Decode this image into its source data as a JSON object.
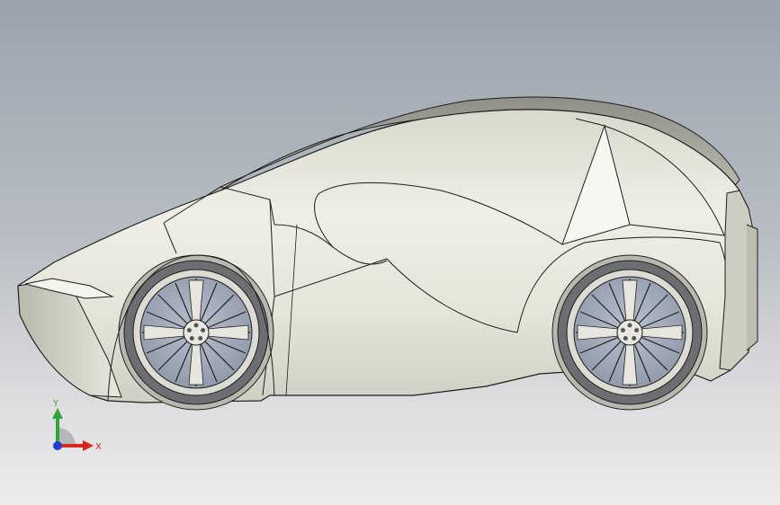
{
  "viewport": {
    "background_top": "#9aa3ad",
    "background_bottom": "#ececee"
  },
  "model": {
    "type": "car-side-view",
    "body_color": "#e7e7dc",
    "edge_color": "#1e1e1e",
    "tire_color": "#6c6e72",
    "rim_color": "#dcdcd4"
  },
  "triad": {
    "x_label": "X",
    "y_label": "Y",
    "x_color": "#d8261f",
    "y_color": "#2ea43a",
    "z_color": "#1f3fd0"
  }
}
